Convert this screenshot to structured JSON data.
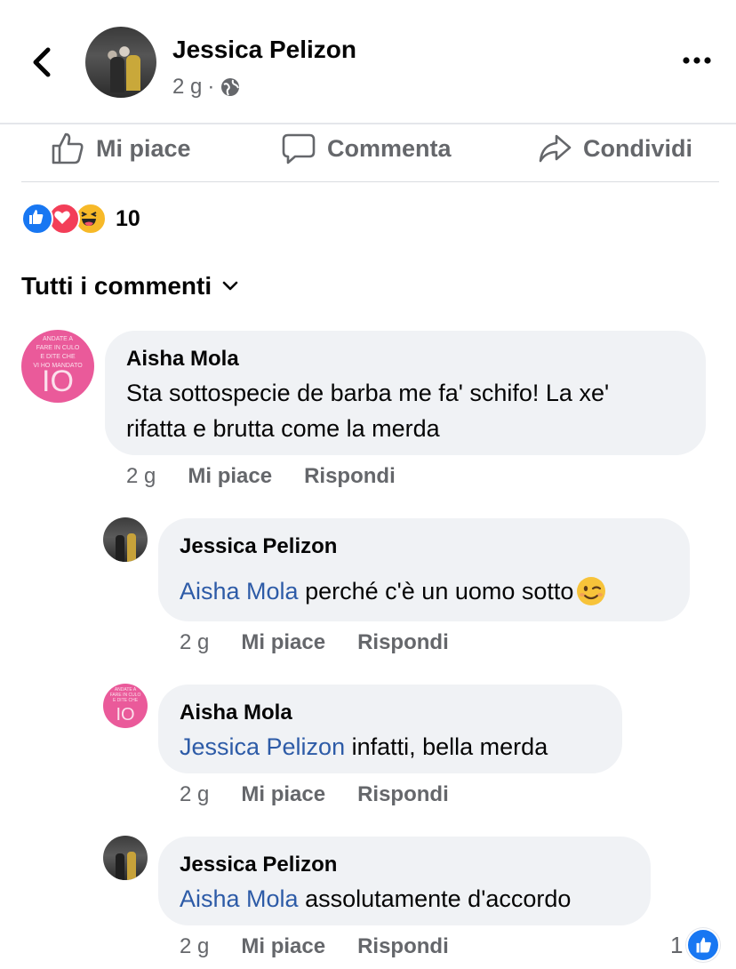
{
  "post": {
    "author": "Jessica Pelizon",
    "time": "2 g",
    "separator": "·",
    "audience_icon": "globe-icon"
  },
  "actions": {
    "like": "Mi piace",
    "comment": "Commenta",
    "share": "Condividi"
  },
  "reactions": {
    "types": [
      "like",
      "love",
      "haha"
    ],
    "count": "10"
  },
  "filter": {
    "label": "Tutti i commenti"
  },
  "avatar_text": {
    "lines": [
      "ANDATE A",
      "FARE IN CULO",
      "E DITE CHE",
      "VI HO MANDATO",
      "IO"
    ]
  },
  "comments": [
    {
      "author": "Aisha Mola",
      "mention": "",
      "text_line1": "Sta sottospecie de barba me fa' schifo! La xe'",
      "text_line2": "rifatta e brutta come la merda",
      "time": "2 g",
      "like": "Mi piace",
      "reply": "Rispondi"
    },
    {
      "author": "Jessica Pelizon",
      "mention": "Aisha Mola",
      "text": " perché c'è un uomo sotto",
      "emoji": "winking-face",
      "time": "2 g",
      "like": "Mi piace",
      "reply": "Rispondi"
    },
    {
      "author": "Aisha Mola",
      "mention": "Jessica Pelizon",
      "text": " infatti, bella merda",
      "time": "2 g",
      "like": "Mi piace",
      "reply": "Rispondi"
    },
    {
      "author": "Jessica Pelizon",
      "mention": "Aisha Mola",
      "text": " assolutamente d'accordo",
      "time": "2 g",
      "like": "Mi piace",
      "reply": "Rispondi",
      "like_count": "1"
    }
  ],
  "colors": {
    "accent": "#1877f2",
    "mention": "#2d5ba7",
    "bubble": "#f0f2f5",
    "meta": "#65676b",
    "avatar_pink": "#ea5a9a"
  }
}
